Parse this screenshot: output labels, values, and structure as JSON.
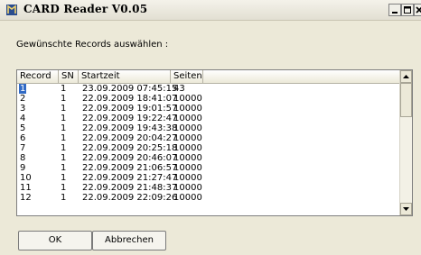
{
  "window": {
    "title": "CARD Reader  V0.05",
    "controls": [
      "minimize",
      "maximize",
      "close"
    ]
  },
  "prompt": "Gewünschte Records auswählen :",
  "table": {
    "columns": [
      "Record",
      "SN",
      "Startzeit",
      "Seiten"
    ],
    "rows": [
      {
        "record": "1",
        "sn": "1",
        "startzeit": "23.09.2009 07:45:15",
        "seiten": "43",
        "selected": true
      },
      {
        "record": "2",
        "sn": "1",
        "startzeit": "22.09.2009 18:41:07",
        "seiten": "10000"
      },
      {
        "record": "3",
        "sn": "1",
        "startzeit": "22.09.2009 19:01:57",
        "seiten": "10000"
      },
      {
        "record": "4",
        "sn": "1",
        "startzeit": "22.09.2009 19:22:47",
        "seiten": "10000"
      },
      {
        "record": "5",
        "sn": "1",
        "startzeit": "22.09.2009 19:43:38",
        "seiten": "10000"
      },
      {
        "record": "6",
        "sn": "1",
        "startzeit": "22.09.2009 20:04:27",
        "seiten": "10000"
      },
      {
        "record": "7",
        "sn": "1",
        "startzeit": "22.09.2009 20:25:18",
        "seiten": "10000"
      },
      {
        "record": "8",
        "sn": "1",
        "startzeit": "22.09.2009 20:46:07",
        "seiten": "10000"
      },
      {
        "record": "9",
        "sn": "1",
        "startzeit": "22.09.2009 21:06:57",
        "seiten": "10000"
      },
      {
        "record": "10",
        "sn": "1",
        "startzeit": "22.09.2009 21:27:47",
        "seiten": "10000"
      },
      {
        "record": "11",
        "sn": "1",
        "startzeit": "22.09.2009 21:48:37",
        "seiten": "10000"
      },
      {
        "record": "12",
        "sn": "1",
        "startzeit": "22.09.2009 22:09:26",
        "seiten": "10000"
      }
    ]
  },
  "buttons": {
    "ok": "OK",
    "cancel": "Abbrechen"
  },
  "colors": {
    "selection": "#316ac5",
    "dialog_bg": "#ece9d8"
  }
}
